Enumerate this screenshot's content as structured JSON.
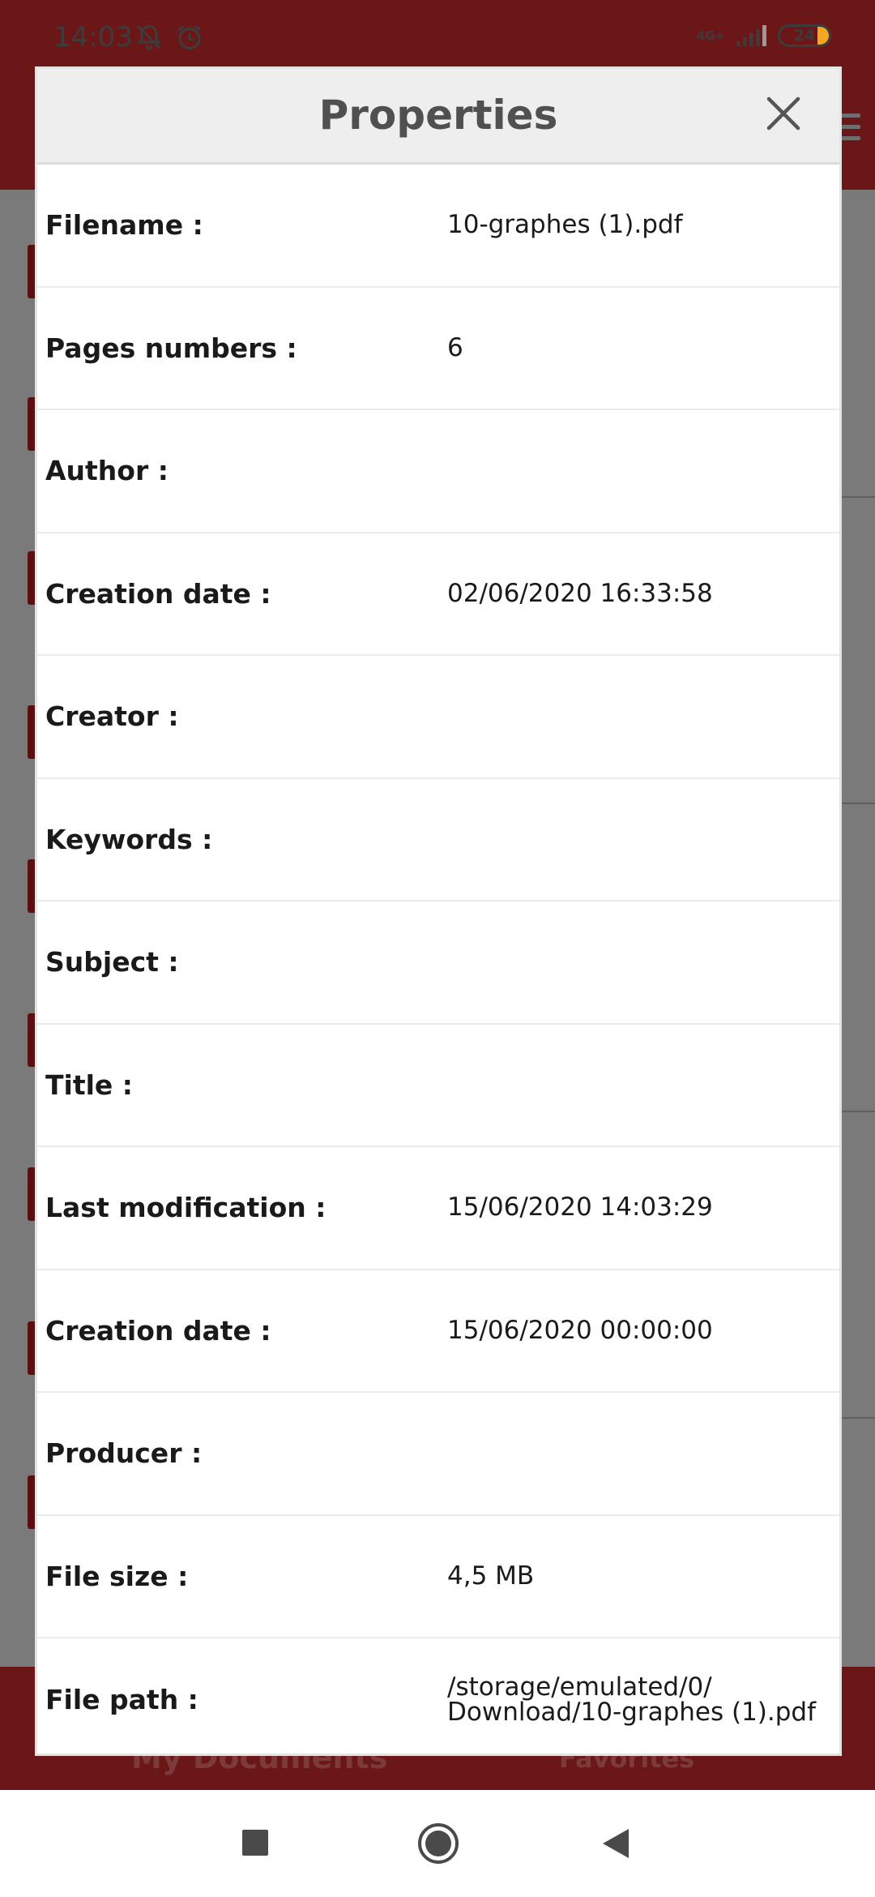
{
  "status_bar": {
    "time": "14:03",
    "network": "4G+",
    "battery": "24",
    "icons": [
      "notifications-off-icon",
      "alarm-icon"
    ]
  },
  "background_app": {
    "tabs": [
      "My Documents",
      "Favorites"
    ],
    "brand_color": "#6b1718"
  },
  "dialog": {
    "title": "Properties",
    "close_icon": "close-icon",
    "rows": [
      {
        "label": "Filename :",
        "value": "10-graphes (1).pdf"
      },
      {
        "label": "Pages numbers :",
        "value": "6"
      },
      {
        "label": "Author :",
        "value": ""
      },
      {
        "label": "Creation date :",
        "value": "02/06/2020 16:33:58"
      },
      {
        "label": "Creator :",
        "value": ""
      },
      {
        "label": "Keywords :",
        "value": ""
      },
      {
        "label": "Subject :",
        "value": ""
      },
      {
        "label": "Title :",
        "value": ""
      },
      {
        "label": "Last modification :",
        "value": "15/06/2020 14:03:29"
      },
      {
        "label": "Creation date :",
        "value": "15/06/2020 00:00:00"
      },
      {
        "label": "Producer :",
        "value": ""
      },
      {
        "label": "File size :",
        "value": "4,5 MB"
      },
      {
        "label": "File path :",
        "value": "/storage/emulated/0/\nDownload/10-graphes (1).pdf"
      }
    ]
  },
  "nav_bar": {
    "buttons": [
      "recents-icon",
      "home-icon",
      "back-icon"
    ]
  }
}
